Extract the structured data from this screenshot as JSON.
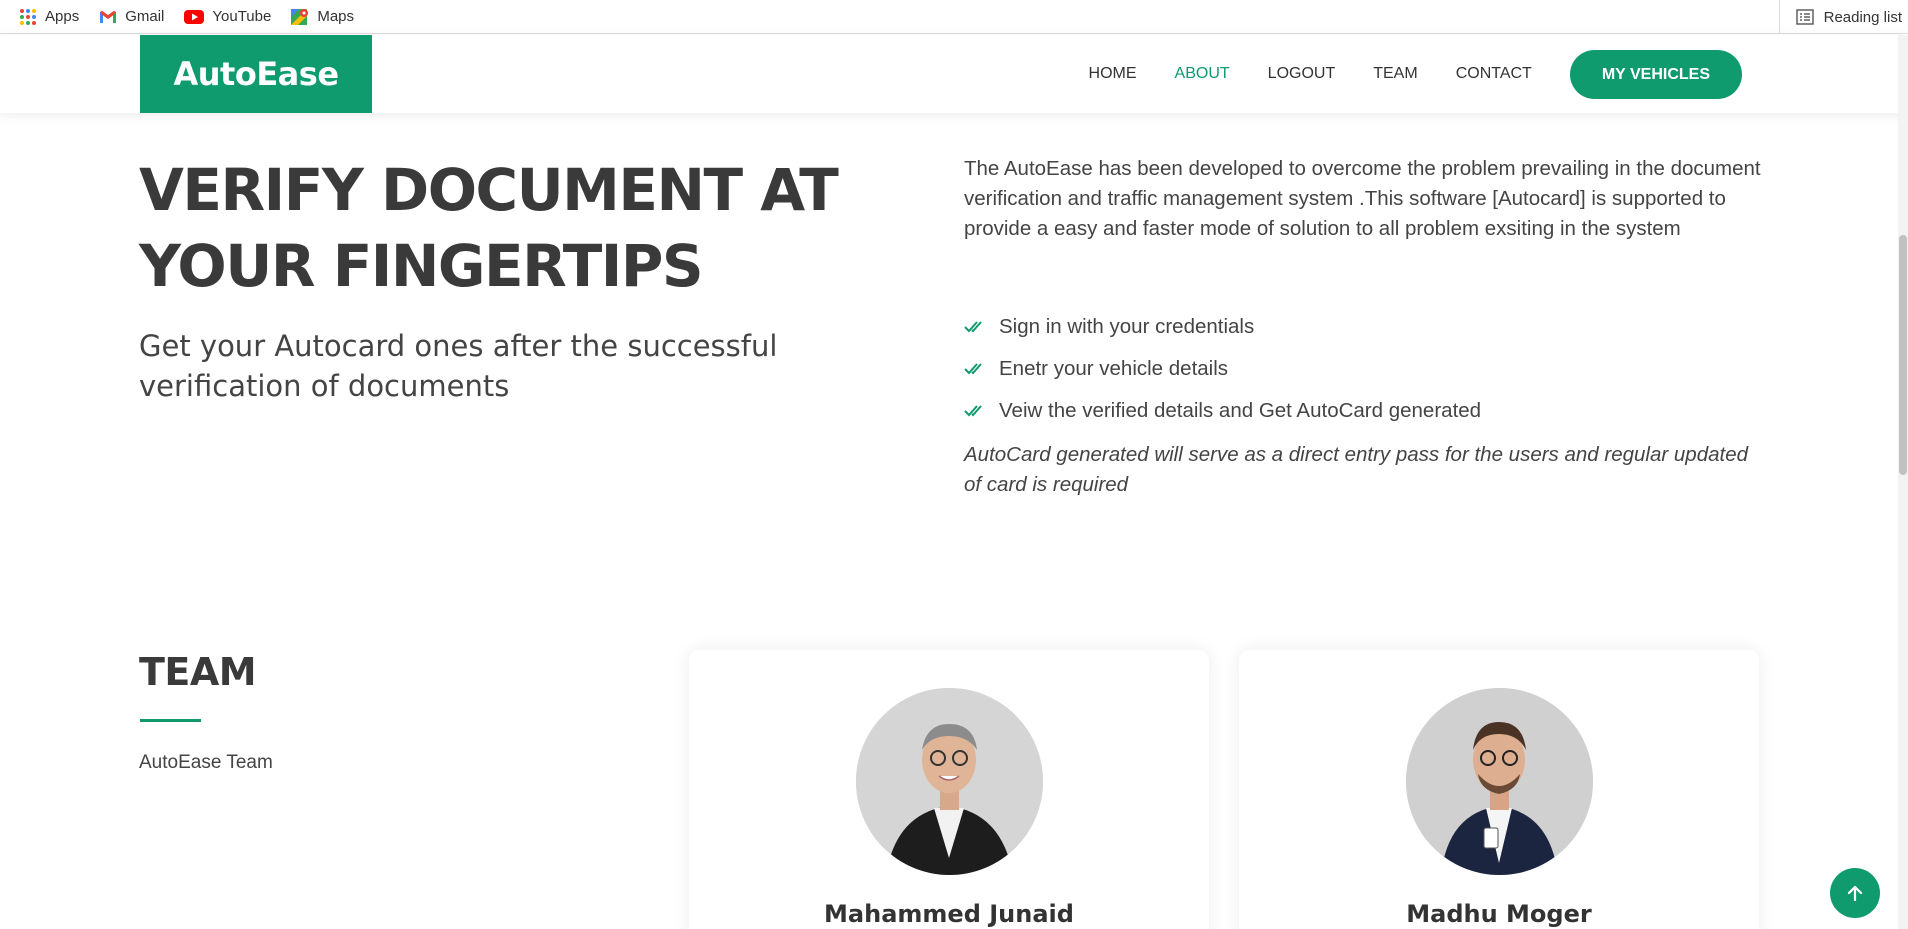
{
  "bookmarks": [
    {
      "label": "Apps",
      "icon": "apps-grid-icon"
    },
    {
      "label": "Gmail",
      "icon": "gmail-icon"
    },
    {
      "label": "YouTube",
      "icon": "youtube-icon"
    },
    {
      "label": "Maps",
      "icon": "maps-icon"
    }
  ],
  "reading_list": {
    "label": "Reading list",
    "icon": "reading-list-icon"
  },
  "header": {
    "logo": "AutoEase",
    "nav": [
      {
        "label": "HOME",
        "active": false
      },
      {
        "label": "ABOUT",
        "active": true
      },
      {
        "label": "LOGOUT",
        "active": false
      },
      {
        "label": "TEAM",
        "active": false
      },
      {
        "label": "CONTACT",
        "active": false
      }
    ],
    "cta": "MY VEHICLES"
  },
  "hero": {
    "title": "VERIFY DOCUMENT AT YOUR FINGERTIPS",
    "subtitle": "Get your Autocard ones after the successful verification of documents"
  },
  "about": {
    "text": "The AutoEase has been developed to overcome the problem prevailing in the document verification and traffic management system .This software [Autocard] is supported to provide a easy and faster mode of solution to all problem exsiting in the system",
    "checks": [
      "Sign in with your credentials",
      "Enetr your vehicle details",
      "Veiw the verified details and Get AutoCard generated"
    ],
    "note": "AutoCard generated will serve as a direct entry pass for the users and regular updated of card is required"
  },
  "team": {
    "title": "TEAM",
    "description": "AutoEase Team",
    "members": [
      {
        "name": "Mahammed Junaid"
      },
      {
        "name": "Madhu Moger"
      }
    ]
  },
  "colors": {
    "accent": "#0f9b6e",
    "text": "#444444"
  }
}
